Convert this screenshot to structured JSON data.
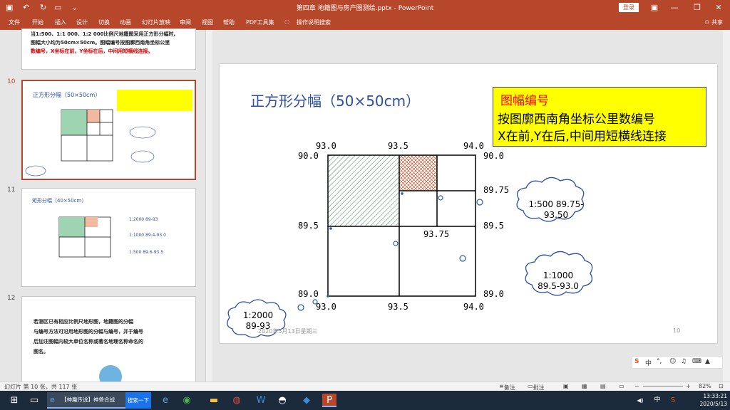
{
  "window": {
    "title": "第四章 地籍图与房产图测绘.pptx - PowerPoint",
    "login_label": "登录"
  },
  "ribbon": {
    "tabs": [
      "文件",
      "开始",
      "插入",
      "设计",
      "切换",
      "动画",
      "幻灯片放映",
      "审阅",
      "视图",
      "帮助",
      "PDF工具集"
    ],
    "tell_me": "操作说明搜索",
    "share": "共享"
  },
  "thumbs": {
    "prev_text_l1": "当1:500、1:1 000、1:2 000比例尺地籍图采用正方形分幅时,",
    "prev_text_l2": "图幅大小均为50cm×50cm。图幅编号按图廓西南角坐标公里",
    "prev_text_l3": "数编号，X坐标在前，Y坐标在后，中间用短横线连接。",
    "n10": "10",
    "n11": "11",
    "n12": "12",
    "t10_title": "正方形分幅（50×50cm）",
    "t11_title": "矩形分幅（40×50cm）",
    "t11_r1": "1:2000  89-93",
    "t11_r2": "1:1000  89.4-93.0",
    "t11_r3": "1:500  89.6-93.5",
    "t12_l1": "若测区已有相应比例尺地形图，地籍图的分幅",
    "t12_l2": "与编号方法可沿用地形图的分幅与编号，并于编号",
    "t12_l3": "后加注图幅内较大单位名称或著名地理名称命名的",
    "t12_l4": "图名。"
  },
  "slide": {
    "title": "正方形分幅（50×50cm）",
    "box_heading": "图幅编号",
    "box_line1": "按图廓西南角坐标公里数编号",
    "box_line2": "X在前,Y在后,中间用短横线连接",
    "top_labels": [
      "93.0",
      "93.5",
      "94.0"
    ],
    "bottom_labels": [
      "93.0",
      "93.5",
      "94.0"
    ],
    "left_labels": [
      "90.0",
      "89.5",
      "89.0"
    ],
    "right_labels": [
      "90.0",
      "89.75",
      "89.5",
      "89.0"
    ],
    "mid_label": "93.75",
    "cloud_500_l1": "1:500 89.75-",
    "cloud_500_l2": "93.50",
    "cloud_1000_l1": "1:1000",
    "cloud_1000_l2": "89.5-93.0",
    "cloud_2000_l1": "1:2000",
    "cloud_2000_l2": "89-93",
    "date": "2020年5月13日星期三",
    "number": "10",
    "hatch_green": "#3a8a5a",
    "hatch_red": "#c0502a"
  },
  "status": {
    "slide_info": "幻灯片 第 10 张，共 117 张",
    "notes": "备注",
    "comments": "批注",
    "zoom": "82%"
  },
  "taskbar": {
    "ie_item": "【神魔传说】神兽合战",
    "search_btn": "搜索一下",
    "time": "13:33:21",
    "date": "2020/5/13",
    "ime": "中"
  }
}
